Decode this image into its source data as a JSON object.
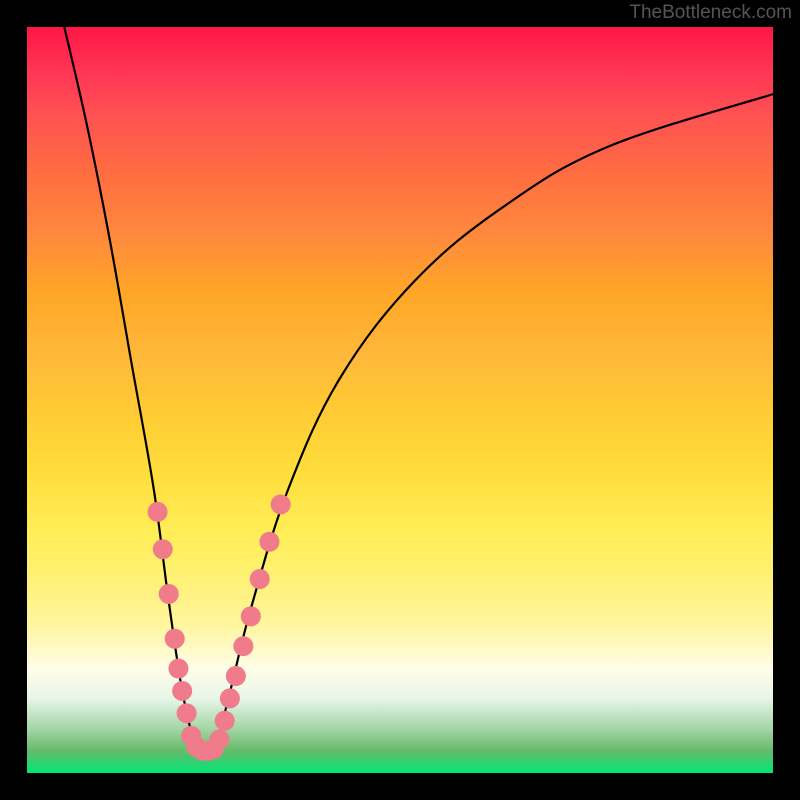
{
  "watermark": "TheBottleneck.com",
  "chart_data": {
    "type": "line",
    "title": "",
    "xlabel": "",
    "ylabel": "",
    "x_range": [
      0,
      100
    ],
    "y_range": [
      0,
      100
    ],
    "background_gradient": {
      "top_color": "#ff1744",
      "bottom_color": "#00e676",
      "description": "red-orange-yellow-green vertical gradient"
    },
    "curve": {
      "description": "V-shaped bottleneck curve with minimum around x=23",
      "minimum_x": 23,
      "points": [
        {
          "x": 5,
          "y": 100
        },
        {
          "x": 8,
          "y": 87
        },
        {
          "x": 11,
          "y": 72
        },
        {
          "x": 14,
          "y": 55
        },
        {
          "x": 17,
          "y": 38
        },
        {
          "x": 19,
          "y": 23
        },
        {
          "x": 21,
          "y": 10
        },
        {
          "x": 23,
          "y": 3
        },
        {
          "x": 25,
          "y": 3
        },
        {
          "x": 27,
          "y": 10
        },
        {
          "x": 30,
          "y": 22
        },
        {
          "x": 35,
          "y": 38
        },
        {
          "x": 42,
          "y": 53
        },
        {
          "x": 52,
          "y": 66
        },
        {
          "x": 64,
          "y": 76
        },
        {
          "x": 78,
          "y": 84
        },
        {
          "x": 100,
          "y": 91
        }
      ]
    },
    "data_points": {
      "color": "#ef7b8b",
      "left_branch": [
        {
          "x": 17.5,
          "y": 35
        },
        {
          "x": 18.2,
          "y": 30
        },
        {
          "x": 19.0,
          "y": 24
        },
        {
          "x": 19.8,
          "y": 18
        },
        {
          "x": 20.3,
          "y": 14
        },
        {
          "x": 20.8,
          "y": 11
        },
        {
          "x": 21.4,
          "y": 8
        },
        {
          "x": 22.0,
          "y": 5
        },
        {
          "x": 22.7,
          "y": 3.5
        }
      ],
      "bottom": [
        {
          "x": 23.5,
          "y": 3
        },
        {
          "x": 24.3,
          "y": 3
        },
        {
          "x": 25.0,
          "y": 3.2
        }
      ],
      "right_branch": [
        {
          "x": 25.8,
          "y": 4.5
        },
        {
          "x": 26.5,
          "y": 7
        },
        {
          "x": 27.2,
          "y": 10
        },
        {
          "x": 28.0,
          "y": 13
        },
        {
          "x": 29.0,
          "y": 17
        },
        {
          "x": 30.0,
          "y": 21
        },
        {
          "x": 31.2,
          "y": 26
        },
        {
          "x": 32.5,
          "y": 31
        },
        {
          "x": 34.0,
          "y": 36
        }
      ]
    }
  }
}
